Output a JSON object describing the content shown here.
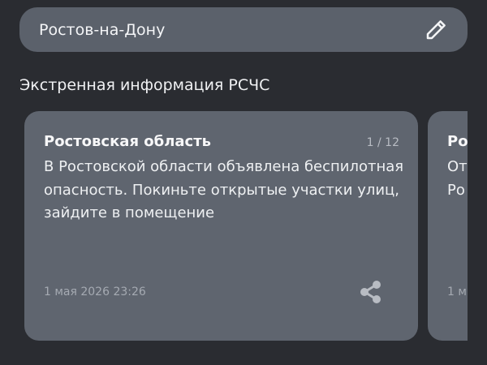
{
  "location": {
    "city": "Ростов-на-Дону",
    "edit_icon": "pencil-icon"
  },
  "section": {
    "title": "Экстренная информация РСЧС"
  },
  "alerts": [
    {
      "region": "Ростовская область",
      "counter": "1 / 12",
      "message": "В Ростовской области объявлена беспилотная опасность. Покиньте открытые участки улиц, зайдите в помещение",
      "date": "1 мая 2026 23:26",
      "share_icon": "share-icon"
    },
    {
      "region": "Ро",
      "message": "От\nРо",
      "date": "1 м"
    }
  ],
  "colors": {
    "background": "#2a2c31",
    "surface": "#5b616b",
    "card": "#5f656f",
    "text": "#f1f2f4",
    "muted_text": "#a5aab2"
  }
}
